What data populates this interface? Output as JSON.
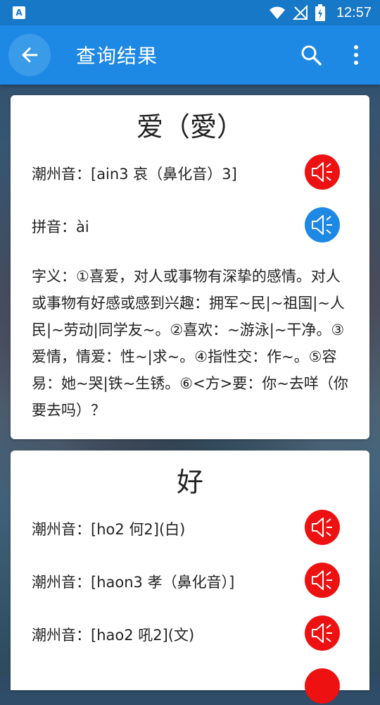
{
  "status_bar": {
    "time": "12:57",
    "left_badge": "A"
  },
  "app_bar": {
    "title": "查询结果"
  },
  "cards": [
    {
      "character": "爱（愛）",
      "rows": [
        {
          "label": "潮州音：[ain3 哀（鼻化音）3]",
          "speaker_color": "red"
        },
        {
          "label": "拼音：ài",
          "speaker_color": "blue"
        }
      ],
      "definition": "字义：①喜爱，对人或事物有深挚的感情。对人或事物有好感或感到兴趣：拥军~民|~祖国|~人民|~劳动|同学友~。②喜欢：~游泳|~干净。③爱情，情爱：性~|求~。④指性交：作~。⑤容易：她~哭|铁~生锈。⑥<方>要：你~去咩（你要去吗）？"
    },
    {
      "character": "好",
      "rows": [
        {
          "label": "潮州音：[ho2 何2](白)",
          "speaker_color": "red"
        },
        {
          "label": "潮州音：[haon3 孝（鼻化音）]",
          "speaker_color": "red"
        },
        {
          "label": "潮州音：[hao2 吼2](文)",
          "speaker_color": "red"
        }
      ]
    }
  ],
  "colors": {
    "app_bar": "#1e88e5",
    "status_bar": "#1778c8",
    "speaker_red": "#ee1111",
    "speaker_blue": "#1e88e5"
  },
  "icons": [
    "back-arrow-icon",
    "search-icon",
    "more-vert-icon",
    "speaker-icon",
    "wifi-icon",
    "signal-icon",
    "battery-icon"
  ]
}
